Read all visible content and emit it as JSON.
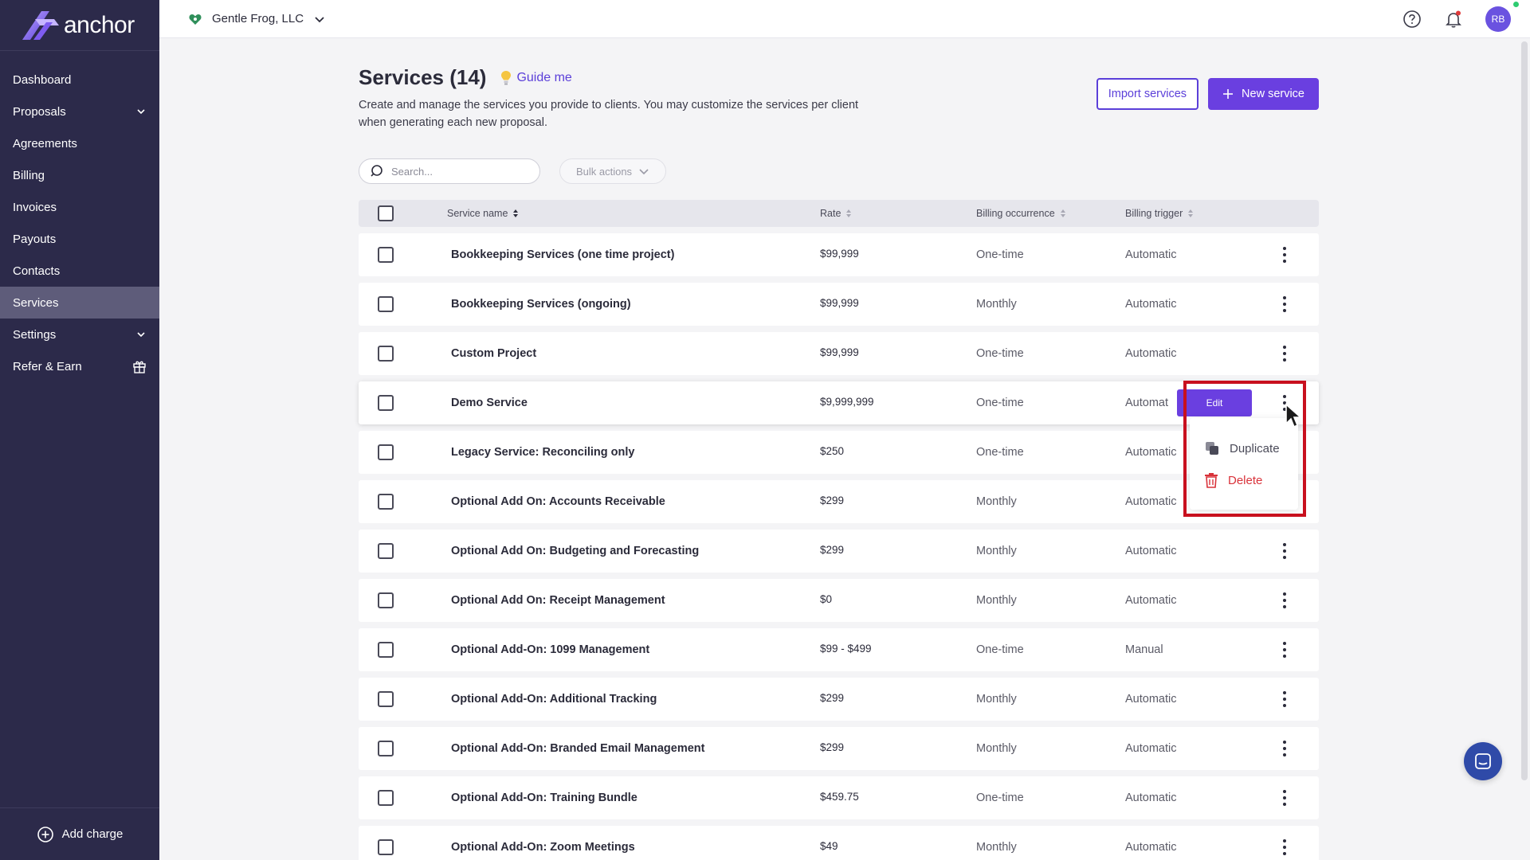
{
  "brand": {
    "logo_text": "anchor"
  },
  "topbar": {
    "company_name": "Gentle Frog, LLC",
    "avatar_initials": "RB"
  },
  "sidebar": {
    "items": [
      {
        "label": "Dashboard"
      },
      {
        "label": "Proposals"
      },
      {
        "label": "Agreements"
      },
      {
        "label": "Billing"
      },
      {
        "label": "Invoices"
      },
      {
        "label": "Payouts"
      },
      {
        "label": "Contacts"
      },
      {
        "label": "Services"
      },
      {
        "label": "Settings"
      },
      {
        "label": "Refer & Earn"
      }
    ],
    "footer_label": "Add charge"
  },
  "page": {
    "title": "Services (14)",
    "guide_label": "Guide me",
    "description": "Create and manage the services you provide to clients. You may customize the services per client when generating each new proposal.",
    "import_button": "Import services",
    "new_button": "New service",
    "search_placeholder": "Search...",
    "bulk_actions": "Bulk actions"
  },
  "table": {
    "headers": {
      "name": "Service name",
      "rate": "Rate",
      "occurrence": "Billing occurrence",
      "trigger": "Billing trigger"
    },
    "rows": [
      {
        "name": "Bookkeeping Services (one time project)",
        "rate": "$99,999",
        "occurrence": "One-time",
        "trigger": "Automatic"
      },
      {
        "name": "Bookkeeping Services (ongoing)",
        "rate": "$99,999",
        "occurrence": "Monthly",
        "trigger": "Automatic"
      },
      {
        "name": "Custom Project",
        "rate": "$99,999",
        "occurrence": "One-time",
        "trigger": "Automatic"
      },
      {
        "name": "Demo Service",
        "rate": "$9,999,999",
        "occurrence": "One-time",
        "trigger": "Automat"
      },
      {
        "name": "Legacy Service: Reconciling only",
        "rate": "$250",
        "occurrence": "One-time",
        "trigger": "Automatic"
      },
      {
        "name": "Optional Add On: Accounts Receivable",
        "rate": "$299",
        "occurrence": "Monthly",
        "trigger": "Automatic"
      },
      {
        "name": "Optional Add On: Budgeting and Forecasting",
        "rate": "$299",
        "occurrence": "Monthly",
        "trigger": "Automatic"
      },
      {
        "name": "Optional Add On: Receipt Management",
        "rate": "$0",
        "occurrence": "Monthly",
        "trigger": "Automatic"
      },
      {
        "name": "Optional Add-On: 1099 Management",
        "rate": "$99 - $499",
        "occurrence": "One-time",
        "trigger": "Manual"
      },
      {
        "name": "Optional Add-On: Additional Tracking",
        "rate": "$299",
        "occurrence": "Monthly",
        "trigger": "Automatic"
      },
      {
        "name": "Optional Add-On: Branded Email Management",
        "rate": "$299",
        "occurrence": "Monthly",
        "trigger": "Automatic"
      },
      {
        "name": "Optional Add-On: Training Bundle",
        "rate": "$459.75",
        "occurrence": "One-time",
        "trigger": "Automatic"
      },
      {
        "name": "Optional Add-On: Zoom Meetings",
        "rate": "$49",
        "occurrence": "Monthly",
        "trigger": "Automatic"
      }
    ]
  },
  "row_actions": {
    "edit": "Edit",
    "duplicate": "Duplicate",
    "delete": "Delete"
  },
  "colors": {
    "sidebar_bg": "#2c2a4a",
    "accent": "#6a3fe0",
    "danger": "#d9323a",
    "highlight": "#c8101e"
  }
}
